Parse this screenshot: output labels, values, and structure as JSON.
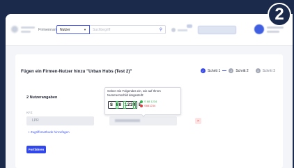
{
  "topbar": {
    "firm_label": "Firmenname",
    "type_select_value": "Nutzer",
    "search_placeholder": "Suchbegriff"
  },
  "card": {
    "title": "Fügen ein Firmen-Nutzer hinzu \"Urban Hubs (Test 2)\"",
    "steps": [
      {
        "label": "Schritt 1",
        "state": "done",
        "number": "✓"
      },
      {
        "label": "Schritt 2",
        "state": "todo",
        "number": "2"
      },
      {
        "label": "Schritt 3",
        "state": "todo",
        "number": "3"
      }
    ],
    "section_title": "2  Nutzerangaben",
    "field_label": "KFZ",
    "input_left_value": "LPR",
    "add_link": "+ Zugriffsmethode hinzufügen",
    "continue_button": "Fortfahren",
    "delete_icon": "x-icon"
  },
  "tooltip": {
    "text": "Geben Sie Folgendes ein, wie auf Ihrem Nummernschild dargestellt:",
    "plate_text": "S 88 1234 E",
    "example_ok": "S 88 1234",
    "example_bad": "S881234"
  },
  "overlay": {
    "step_badge": "2"
  },
  "colors": {
    "accent": "#3147ea",
    "background": "#1b2a4a",
    "ok": "#2fb84f",
    "error": "#e23b3b"
  }
}
